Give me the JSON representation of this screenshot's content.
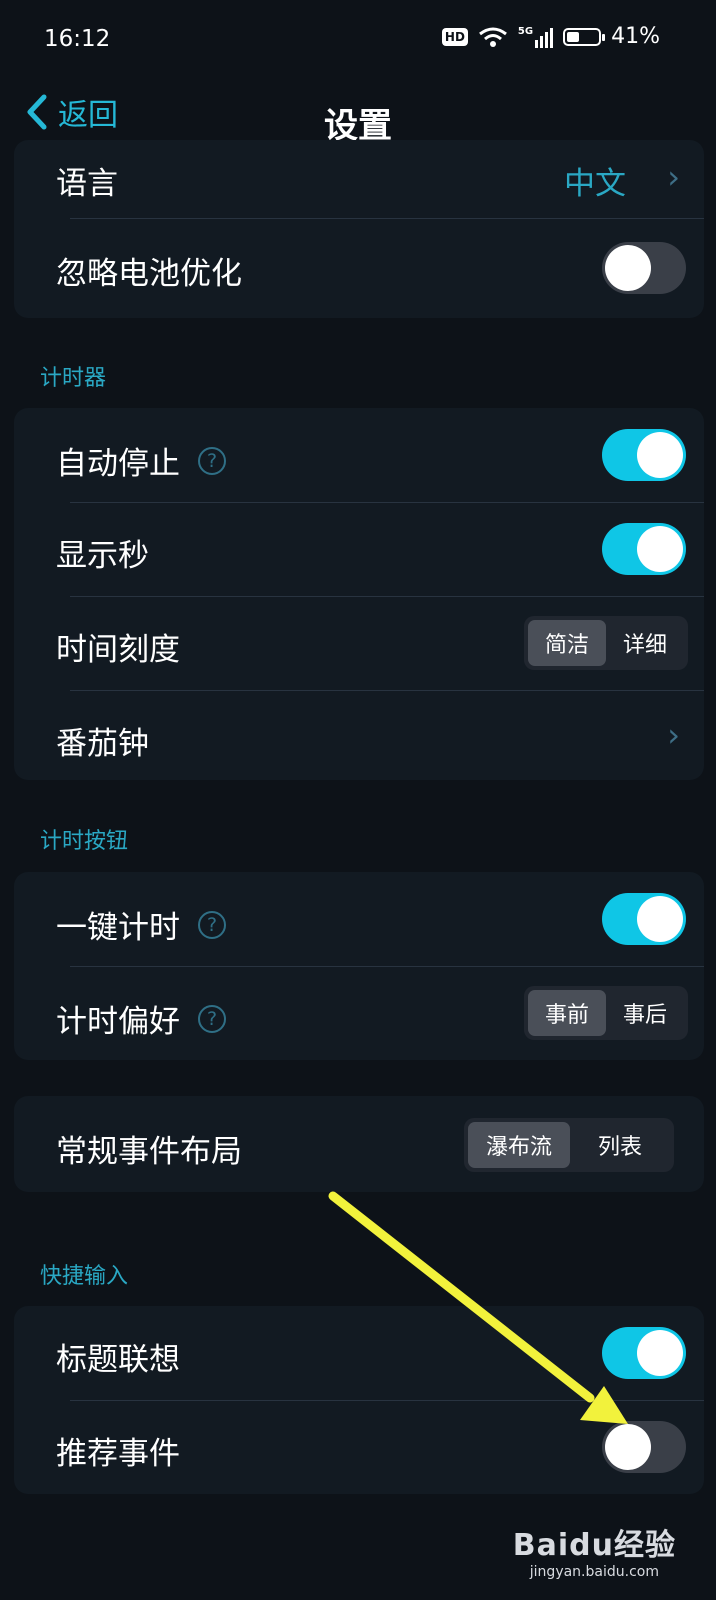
{
  "status_bar": {
    "time": "16:12",
    "hd": "HD",
    "network": "5G",
    "battery_level": 0.41,
    "battery_text": "41%"
  },
  "nav": {
    "back_label": "返回",
    "title": "设置"
  },
  "general": {
    "language": {
      "label": "语言",
      "value": "中文"
    },
    "ignore_battery": {
      "label": "忽略电池优化",
      "on": false
    }
  },
  "timer": {
    "section_title": "计时器",
    "auto_stop": {
      "label": "自动停止",
      "on": true
    },
    "show_seconds": {
      "label": "显示秒",
      "on": true
    },
    "time_scale": {
      "label": "时间刻度",
      "options": [
        "简洁",
        "详细"
      ],
      "selected": 0
    },
    "pomodoro": {
      "label": "番茄钟"
    }
  },
  "timer_button": {
    "section_title": "计时按钮",
    "one_key": {
      "label": "一键计时",
      "on": true
    },
    "preference": {
      "label": "计时偏好",
      "options": [
        "事前",
        "事后"
      ],
      "selected": 0
    }
  },
  "layout": {
    "event_layout": {
      "label": "常规事件布局",
      "options": [
        "瀑布流",
        "列表"
      ],
      "selected": 0
    }
  },
  "quick_input": {
    "section_title": "快捷输入",
    "title_suggest": {
      "label": "标题联想",
      "on": true
    },
    "recommend": {
      "label": "推荐事件",
      "on": false
    }
  },
  "help_glyph": "?",
  "colors": {
    "accent": "#0fc6e6",
    "link": "#2aa8c4",
    "background": "#0d1218",
    "card": "#121a22",
    "annotation_arrow": "#f2f23c"
  },
  "watermark": {
    "brand": "Baidu经验",
    "url": "jingyan.baidu.com"
  }
}
